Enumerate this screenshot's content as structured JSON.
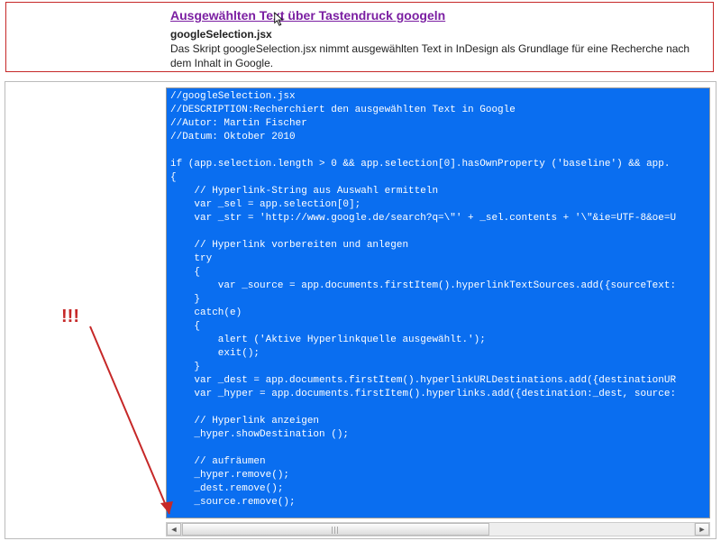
{
  "header": {
    "link_text": "Ausgewählten Text über Tastendruck googeln",
    "filename": "googleSelection.jsx",
    "description": "Das Skript googleSelection.jsx nimmt ausgewählten Text in InDesign als Grundlage für eine Recherche nach dem Inhalt in Google."
  },
  "annotation": {
    "exclaim": "!!!"
  },
  "scrollbar": {
    "left_arrow": "◄",
    "right_arrow": "►"
  },
  "code": {
    "text": "//googleSelection.jsx\n//DESCRIPTION:Recherchiert den ausgewählten Text in Google\n//Autor: Martin Fischer\n//Datum: Oktober 2010\n\nif (app.selection.length > 0 && app.selection[0].hasOwnProperty ('baseline') && app.\n{\n    // Hyperlink-String aus Auswahl ermitteln\n    var _sel = app.selection[0];\n    var _str = 'http://www.google.de/search?q=\\\"' + _sel.contents + '\\\"&ie=UTF-8&oe=U\n\n    // Hyperlink vorbereiten und anlegen\n    try\n    {\n        var _source = app.documents.firstItem().hyperlinkTextSources.add({sourceText:\n    }\n    catch(e)\n    {\n        alert ('Aktive Hyperlinkquelle ausgewählt.');\n        exit();\n    }\n    var _dest = app.documents.firstItem().hyperlinkURLDestinations.add({destinationUR\n    var _hyper = app.documents.firstItem().hyperlinks.add({destination:_dest, source:\n\n    // Hyperlink anzeigen\n    _hyper.showDestination ();\n\n    // aufräumen\n    _hyper.remove();\n    _dest.remove();\n    _source.remove();"
  }
}
